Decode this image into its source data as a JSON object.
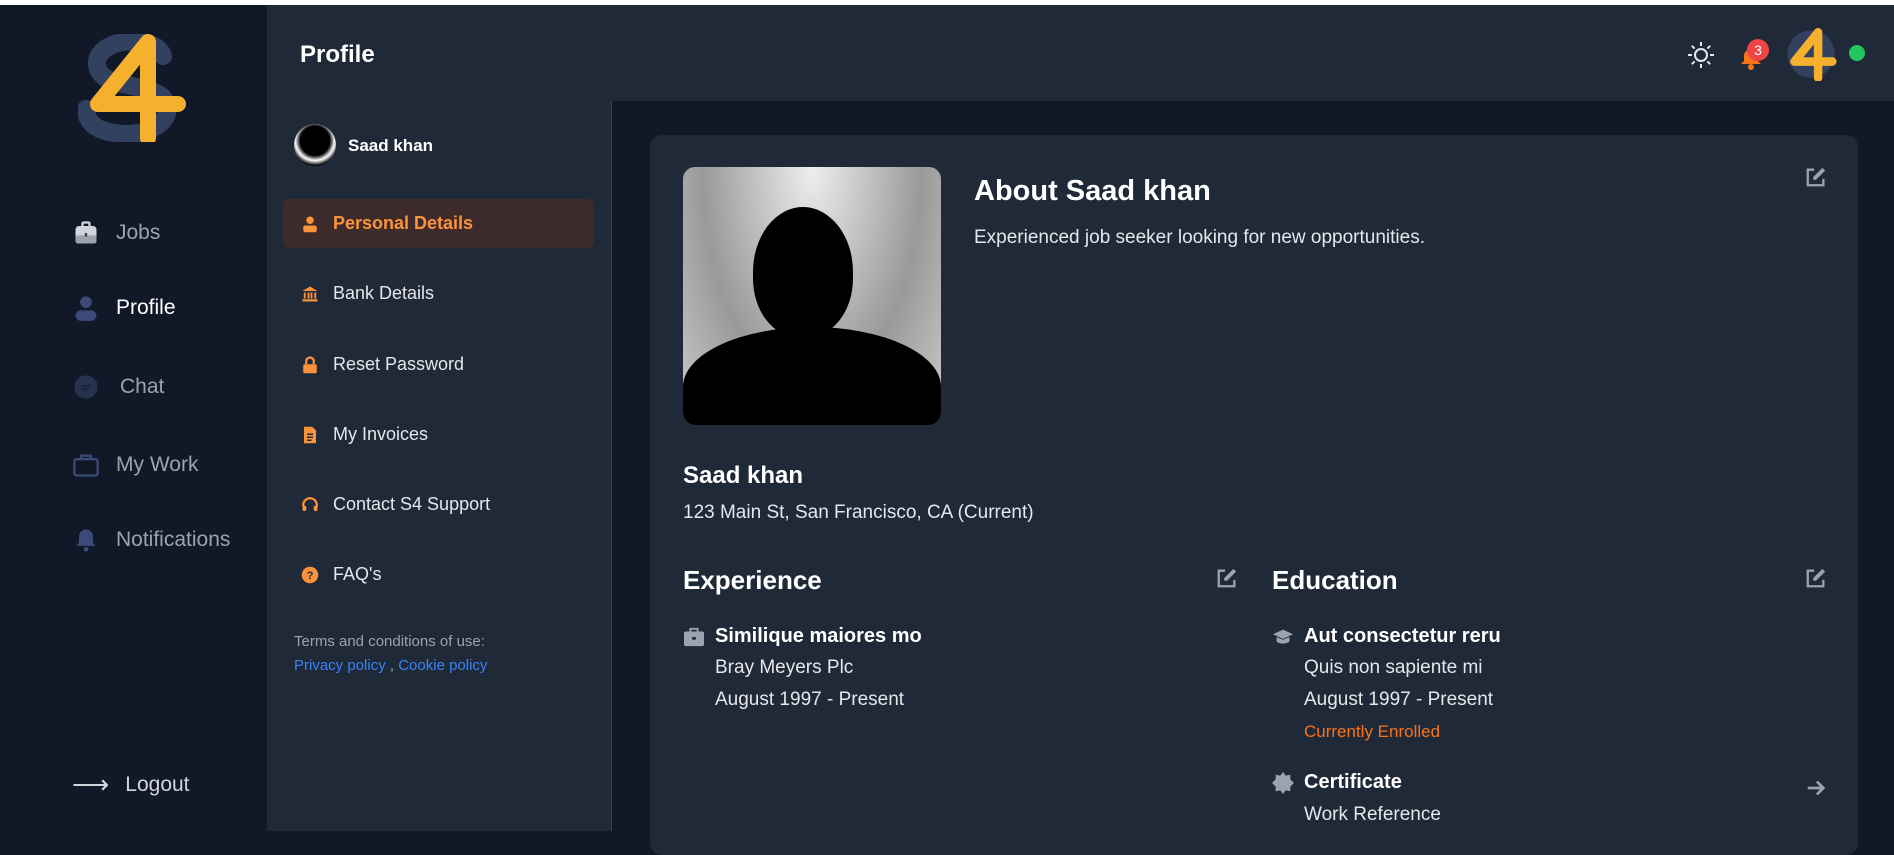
{
  "header": {
    "title": "Profile",
    "notification_count": "3"
  },
  "sidebar": {
    "items": [
      {
        "label": "Jobs",
        "icon": "briefcase-icon"
      },
      {
        "label": "Profile",
        "icon": "user-icon",
        "active": true
      },
      {
        "label": "Chat",
        "icon": "chat-icon"
      },
      {
        "label": "My Work",
        "icon": "work-bag-icon"
      },
      {
        "label": "Notifications",
        "icon": "bell-icon"
      }
    ],
    "logout": "Logout"
  },
  "profile_menu": {
    "user_name": "Saad khan",
    "items": [
      {
        "label": "Personal Details",
        "icon": "user-icon",
        "active": true
      },
      {
        "label": "Bank Details",
        "icon": "bank-icon"
      },
      {
        "label": "Reset Password",
        "icon": "lock-icon"
      },
      {
        "label": "My Invoices",
        "icon": "invoice-icon"
      },
      {
        "label": "Contact S4 Support",
        "icon": "headset-icon"
      },
      {
        "label": "FAQ's",
        "icon": "question-icon"
      }
    ],
    "terms_label": "Terms and conditions of use:",
    "privacy": "Privacy policy",
    "separator": ",",
    "cookie": "Cookie policy"
  },
  "about": {
    "title": "About Saad khan",
    "description": "Experienced job seeker looking for new opportunities.",
    "name": "Saad khan",
    "address": "123 Main St, San Francisco, CA (Current)"
  },
  "experience": {
    "title": "Experience",
    "items": [
      {
        "title": "Similique maiores mo",
        "company": "Bray Meyers Plc",
        "dates": "August 1997 - Present"
      }
    ]
  },
  "education": {
    "title": "Education",
    "items": [
      {
        "title": "Aut consectetur reru",
        "school": "Quis non sapiente mi",
        "dates": "August 1997 - Present",
        "status": "Currently Enrolled"
      }
    ],
    "certificate": {
      "title": "Certificate",
      "subtitle": "Work Reference"
    }
  },
  "colors": {
    "accent": "#fb923c",
    "link": "#3b82f6",
    "online": "#22c55e",
    "badge": "#ef4444",
    "logo_yellow": "#f5b02e",
    "logo_navy": "#334160"
  }
}
